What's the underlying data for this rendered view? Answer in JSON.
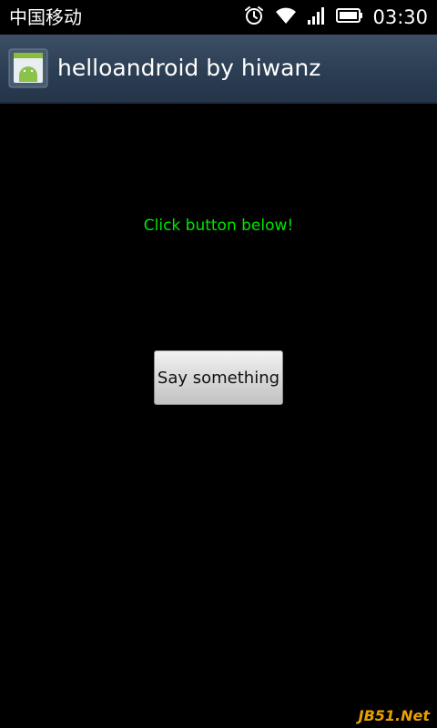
{
  "status_bar": {
    "carrier": "中国移动",
    "time": "03:30",
    "icons": [
      "alarm-icon",
      "wifi-icon",
      "signal-icon",
      "battery-icon"
    ]
  },
  "title_bar": {
    "app_icon": "android-app-icon",
    "title": "helloandroid by hiwanz"
  },
  "main": {
    "prompt_text": "Click button below!",
    "button_label": "Say something"
  },
  "watermark": "JB51.Net",
  "colors": {
    "prompt_text": "#00e600",
    "title_bar": "#2c3e53",
    "background": "#000000"
  }
}
